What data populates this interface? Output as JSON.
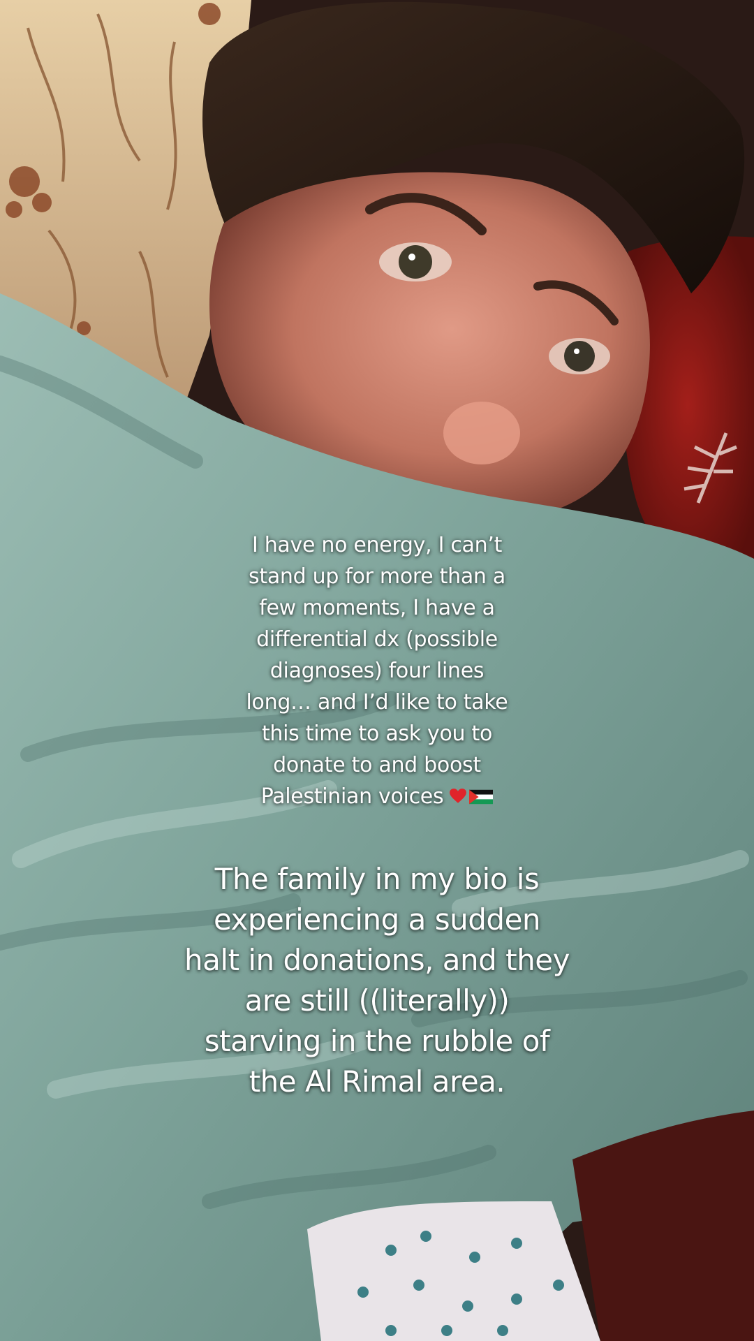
{
  "photo": {
    "subject": "selfie-in-bed",
    "colors": {
      "blanket": "#8fb3a9",
      "blanket_shadow": "#4e6f69",
      "pillow_floral": "#d8b88c",
      "pillow_red": "#8e1a16",
      "skin": "#c98570",
      "hair": "#2a1c15",
      "sheet_dots": "#3d7f86"
    }
  },
  "overlay": {
    "caption_1": {
      "lines": [
        "I have no energy, I can’t",
        "stand up for more than a",
        "few moments, I have a",
        "differential dx (possible",
        "diagnoses) four lines",
        "long… and I’d like to take",
        "this time to ask you to",
        "donate to and boost",
        "Palestinian voices"
      ],
      "emoji": [
        "heart-icon",
        "palestine-flag-icon"
      ]
    },
    "caption_2": {
      "lines": [
        "The family in my bio is",
        "experiencing a sudden",
        "halt in donations, and they",
        "are still ((literally))",
        "starving in the rubble of",
        "the Al Rimal area."
      ]
    }
  }
}
